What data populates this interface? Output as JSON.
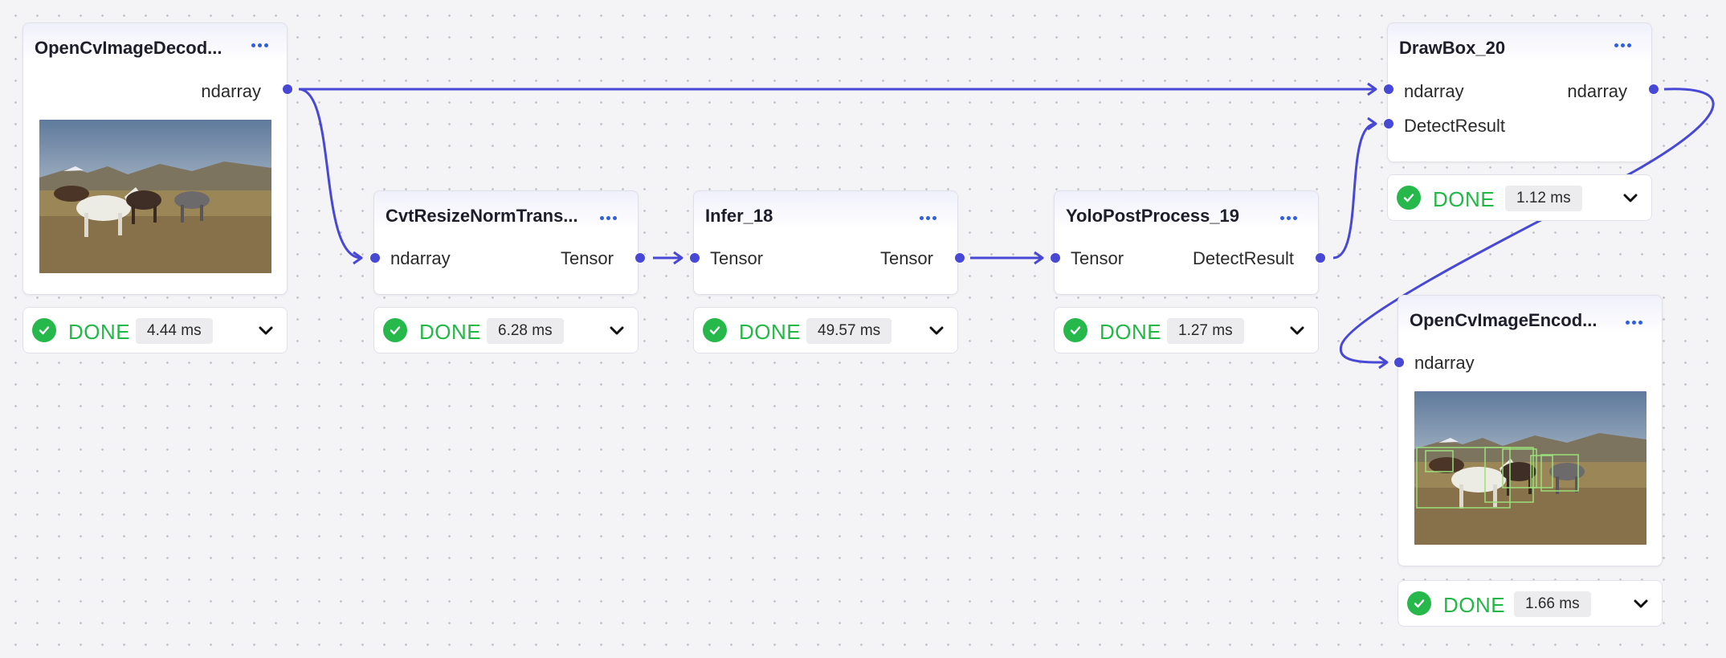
{
  "accent_color": "#4848d6",
  "status_color": "#22b845",
  "icons": {
    "menu": "ellipsis-icon",
    "status": "check-circle-icon",
    "toggle": "chevron-down-icon"
  },
  "nodes": {
    "decode": {
      "title": "OpenCvImageDecod...",
      "output": "ndarray",
      "status": "DONE",
      "time": "4.44 ms"
    },
    "resize": {
      "title": "CvtResizeNormTrans...",
      "input": "ndarray",
      "output": "Tensor",
      "status": "DONE",
      "time": "6.28 ms"
    },
    "infer": {
      "title": "Infer_18",
      "input": "Tensor",
      "output": "Tensor",
      "status": "DONE",
      "time": "49.57 ms"
    },
    "yolo": {
      "title": "YoloPostProcess_19",
      "input": "Tensor",
      "output": "DetectResult",
      "status": "DONE",
      "time": "1.27 ms"
    },
    "drawbox": {
      "title": "DrawBox_20",
      "input_image": "ndarray",
      "input_detect": "DetectResult",
      "output": "ndarray",
      "status": "DONE",
      "time": "1.12 ms"
    },
    "encode": {
      "title": "OpenCvImageEncod...",
      "input": "ndarray",
      "status": "DONE",
      "time": "1.66 ms"
    }
  }
}
